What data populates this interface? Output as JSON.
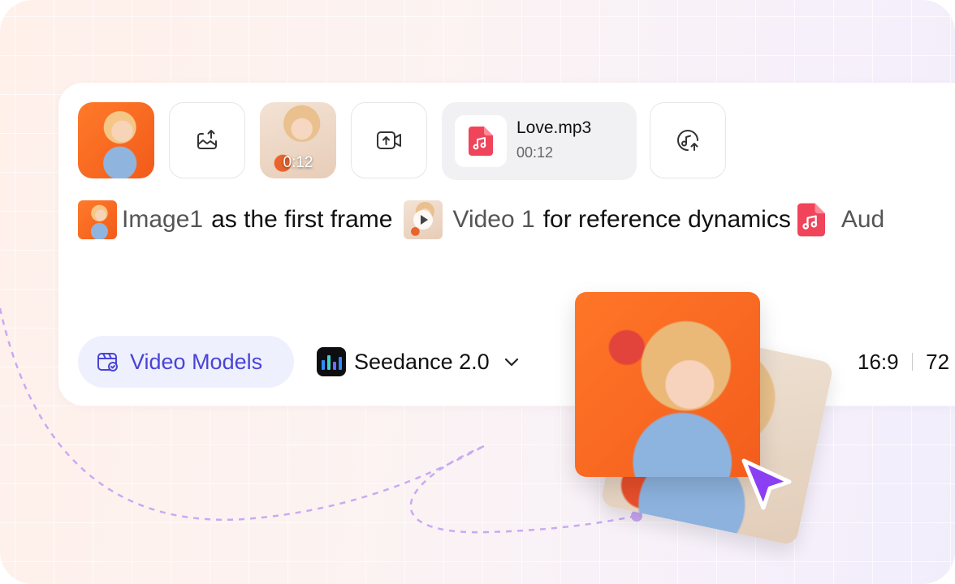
{
  "media_row": {
    "video_thumb_duration": "0:12",
    "audio": {
      "file_name": "Love.mp3",
      "duration": "00:12"
    }
  },
  "prompt": {
    "image_ref": "Image1",
    "text1": "as the first frame",
    "video_ref": "Video 1",
    "text2": "for reference dynamics",
    "audio_ref": "Aud"
  },
  "toolbar": {
    "category_label": "Video Models",
    "model_name": "Seedance 2.0",
    "aspect_ratio": "16:9",
    "resolution": "72"
  },
  "colors": {
    "accent": "#4a43d6",
    "accent_bg": "#eef0fe",
    "audio_red": "#f0445a",
    "cursor_purple": "#8b3ff2",
    "dashed_path": "#c6a6f0"
  },
  "icons": {
    "image_upload": "image-upload-icon",
    "video_upload": "video-upload-icon",
    "audio_upload": "audio-upload-icon",
    "audio_file": "music-file-icon",
    "models": "video-models-icon",
    "model_logo": "seedance-logo-icon",
    "dropdown": "chevron-down-icon",
    "pointer": "cursor-pointer-icon"
  }
}
